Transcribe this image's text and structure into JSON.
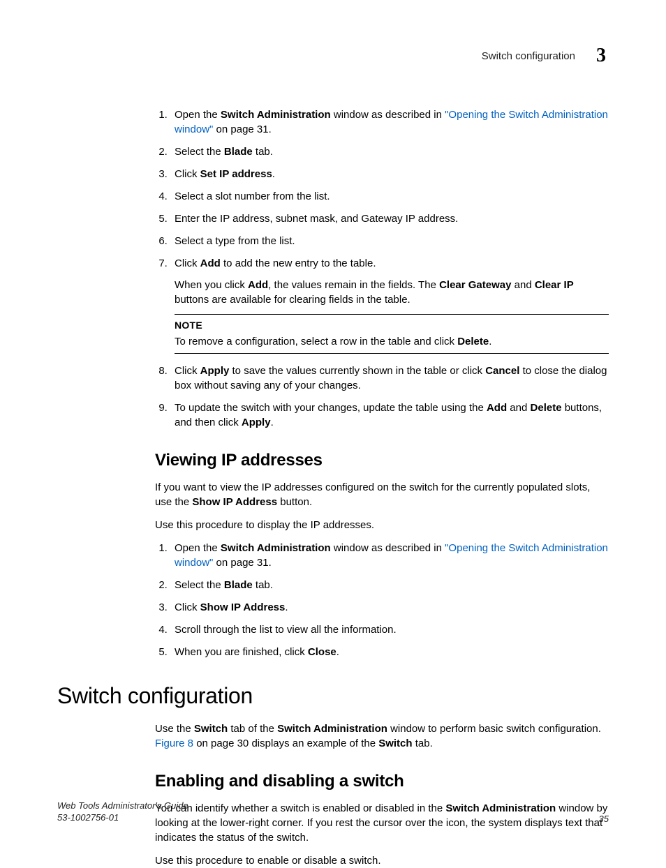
{
  "header": {
    "title": "Switch configuration",
    "chapter": "3"
  },
  "proc1": {
    "step1_a": "Open the ",
    "step1_b": "Switch Administration",
    "step1_c": " window as described in ",
    "step1_link": "\"Opening the Switch Administration window\"",
    "step1_d": " on page 31.",
    "step2_a": "Select the ",
    "step2_b": "Blade",
    "step2_c": " tab.",
    "step3_a": "Click ",
    "step3_b": "Set IP address",
    "step3_c": ".",
    "step4": "Select a slot number from the list.",
    "step5": "Enter the IP address, subnet mask, and Gateway IP address.",
    "step6": "Select a type from the list.",
    "step7_a": "Click ",
    "step7_b": "Add",
    "step7_c": " to add the new entry to the table.",
    "step7_sub_a": "When you click ",
    "step7_sub_b": "Add",
    "step7_sub_c": ", the values remain in the fields. The ",
    "step7_sub_d": "Clear Gateway",
    "step7_sub_e": " and ",
    "step7_sub_f": "Clear IP",
    "step7_sub_g": " buttons are available for clearing fields in the table.",
    "note_label": "NOTE",
    "note_a": "To remove a configuration, select a row in the table and click ",
    "note_b": "Delete",
    "note_c": ".",
    "step8_a": "Click ",
    "step8_b": "Apply",
    "step8_c": " to save the values currently shown in the table or click ",
    "step8_d": "Cancel",
    "step8_e": " to close the dialog box without saving any of your changes.",
    "step9_a": "To update the switch with your changes, update the table using the ",
    "step9_b": "Add",
    "step9_c": " and ",
    "step9_d": "Delete",
    "step9_e": " buttons, and then click ",
    "step9_f": "Apply",
    "step9_g": "."
  },
  "heading_viewing": "Viewing IP addresses",
  "viewing": {
    "para1_a": "If you want to view the IP addresses configured on the switch for the currently populated slots, use the ",
    "para1_b": "Show IP Address",
    "para1_c": " button.",
    "para2": "Use this procedure to display the IP addresses.",
    "step1_a": "Open the ",
    "step1_b": "Switch Administration",
    "step1_c": " window as described in ",
    "step1_link": "\"Opening the Switch Administration window\"",
    "step1_d": " on page 31.",
    "step2_a": "Select the ",
    "step2_b": "Blade",
    "step2_c": " tab.",
    "step3_a": "Click ",
    "step3_b": "Show IP Address",
    "step3_c": ".",
    "step4": "Scroll through the list to view all the information.",
    "step5_a": "When you are finished, click ",
    "step5_b": "Close",
    "step5_c": "."
  },
  "heading_switch": "Switch configuration",
  "switch": {
    "para1_a": "Use the ",
    "para1_b": "Switch",
    "para1_c": " tab of the ",
    "para1_d": "Switch Administration",
    "para1_e": " window to perform basic switch configuration. ",
    "para1_link": "Figure 8",
    "para1_f": " on page 30 displays an example of the ",
    "para1_g": "Switch",
    "para1_h": " tab."
  },
  "heading_enable": "Enabling and disabling a switch",
  "enable": {
    "para1_a": "You can identify whether a switch is enabled or disabled in the ",
    "para1_b": "Switch Administration",
    "para1_c": " window by looking at the lower-right corner. If you rest the cursor over the icon, the system displays text that indicates the status of the switch.",
    "para2": "Use this procedure to enable or disable a switch."
  },
  "footer": {
    "guide": "Web Tools Administrator's Guide",
    "docnum": "53-1002756-01",
    "page": "35"
  }
}
